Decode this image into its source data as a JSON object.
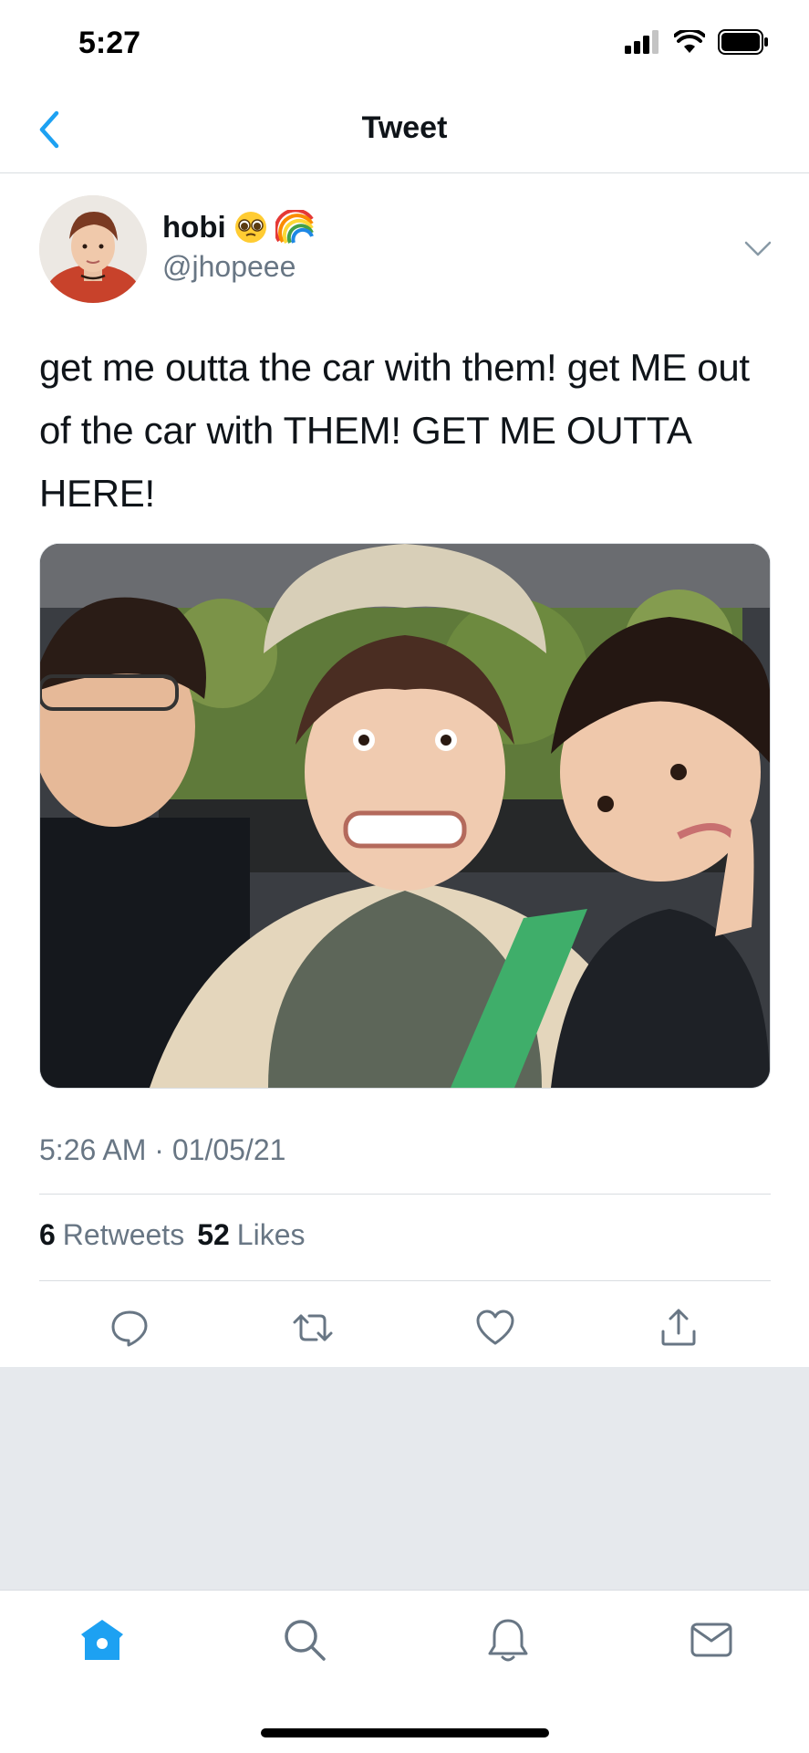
{
  "status_bar": {
    "time": "5:27"
  },
  "nav": {
    "title": "Tweet"
  },
  "tweet": {
    "display_name": "hobi",
    "name_emojis": [
      "🥺",
      "🌈"
    ],
    "handle": "@jhopeee",
    "text": "get me outta the car with them! get ME out of the car with THEM! GET ME OUTTA HERE!",
    "timestamp": "5:26 AM · 01/05/21",
    "retweet_count": "6",
    "retweet_label": "Retweets",
    "like_count": "52",
    "like_label": "Likes"
  },
  "colors": {
    "accent": "#1da1f2",
    "secondary_text": "#687684",
    "separator": "#d9dde1",
    "background_gray": "#e6e9ed"
  },
  "icons": {
    "actions": [
      "reply-icon",
      "retweet-icon",
      "like-icon",
      "share-icon"
    ],
    "tabs": [
      "home-icon",
      "search-icon",
      "notifications-icon",
      "messages-icon"
    ]
  },
  "tab_bar": {
    "active_tab": "home"
  }
}
